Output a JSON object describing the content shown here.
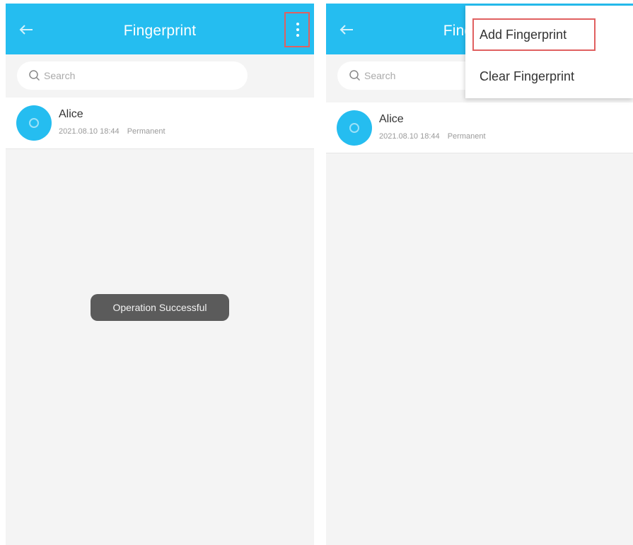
{
  "screens": [
    {
      "header": {
        "title": "Fingerprint"
      },
      "search": {
        "placeholder": "Search"
      },
      "list": [
        {
          "name": "Alice",
          "datetime": "2021.08.10 18:44",
          "validity": "Permanent"
        }
      ],
      "toast": "Operation Successful"
    },
    {
      "header": {
        "title": "Fingerprint"
      },
      "search": {
        "placeholder": "Search"
      },
      "list": [
        {
          "name": "Alice",
          "datetime": "2021.08.10 18:44",
          "validity": "Permanent"
        }
      ],
      "menu": {
        "items": [
          {
            "label": "Add Fingerprint",
            "highlighted": true
          },
          {
            "label": "Clear Fingerprint",
            "highlighted": false
          }
        ]
      }
    }
  ],
  "colors": {
    "header": "#25bdf0",
    "background": "#f4f4f4",
    "highlight_border": "#e06060",
    "toast": "#5b5b5b"
  },
  "icons": {
    "back": "arrow-left-icon",
    "more": "more-vertical-icon",
    "search": "search-icon",
    "avatar": "fingerprint-avatar-icon"
  }
}
